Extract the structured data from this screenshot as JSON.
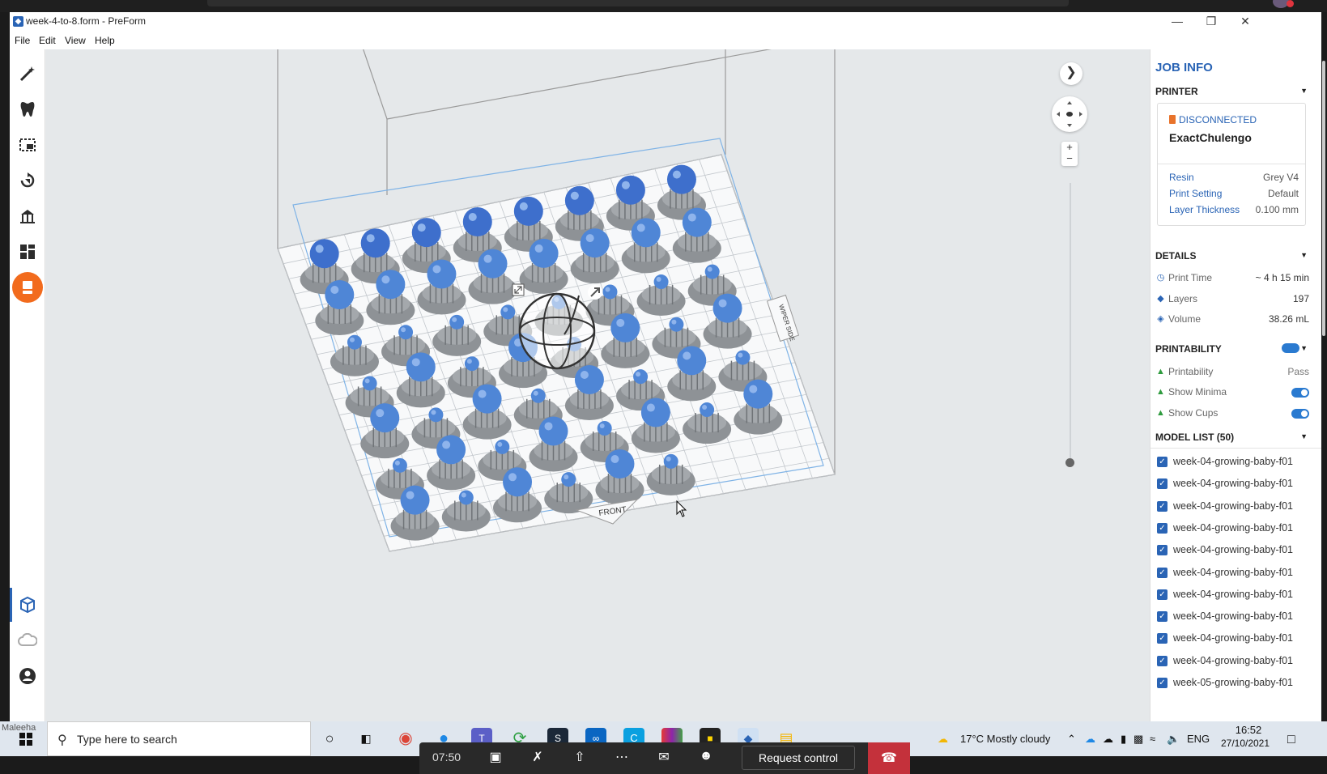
{
  "window": {
    "title": "week-4-to-8.form - PreForm"
  },
  "menu": [
    "File",
    "Edit",
    "View",
    "Help"
  ],
  "toolbar": {
    "tools": [
      "magic-wand-icon",
      "tooth-icon",
      "select-box-icon",
      "orient-icon",
      "supports-icon",
      "layout-icon",
      "print-icon",
      "cube-view-icon",
      "cloud-icon",
      "account-icon"
    ]
  },
  "viewport": {
    "front_label": "FRONT",
    "side_label": "WIPER SIDE"
  },
  "job_info": {
    "heading": "JOB INFO",
    "printer": {
      "section": "PRINTER",
      "status": "DISCONNECTED",
      "name": "ExactChulengo",
      "resin_label": "Resin",
      "resin_value": "Grey V4",
      "setting_label": "Print Setting",
      "setting_value": "Default",
      "thickness_label": "Layer Thickness",
      "thickness_value": "0.100 mm"
    },
    "details": {
      "section": "DETAILS",
      "print_time_label": "Print Time",
      "print_time_value": "~ 4 h 15 min",
      "layers_label": "Layers",
      "layers_value": "197",
      "volume_label": "Volume",
      "volume_value": "38.26 mL"
    },
    "printability": {
      "section": "PRINTABILITY",
      "printability_label": "Printability",
      "printability_value": "Pass",
      "minima_label": "Show Minima",
      "cups_label": "Show Cups"
    },
    "model_list": {
      "section": "MODEL LIST (50)",
      "items": [
        "week-04-growing-baby-f01",
        "week-04-growing-baby-f01",
        "week-04-growing-baby-f01",
        "week-04-growing-baby-f01",
        "week-04-growing-baby-f01",
        "week-04-growing-baby-f01",
        "week-04-growing-baby-f01",
        "week-04-growing-baby-f01",
        "week-04-growing-baby-f01",
        "week-04-growing-baby-f01",
        "week-05-growing-baby-f01"
      ]
    }
  },
  "taskbar": {
    "user_label": "Maleeha",
    "search_placeholder": "Type here to search",
    "weather": "17°C  Mostly cloudy",
    "lang": "ENG",
    "time": "16:52",
    "date": "27/10/2021"
  },
  "meeting": {
    "elapsed": "07:50",
    "request_control": "Request control"
  }
}
